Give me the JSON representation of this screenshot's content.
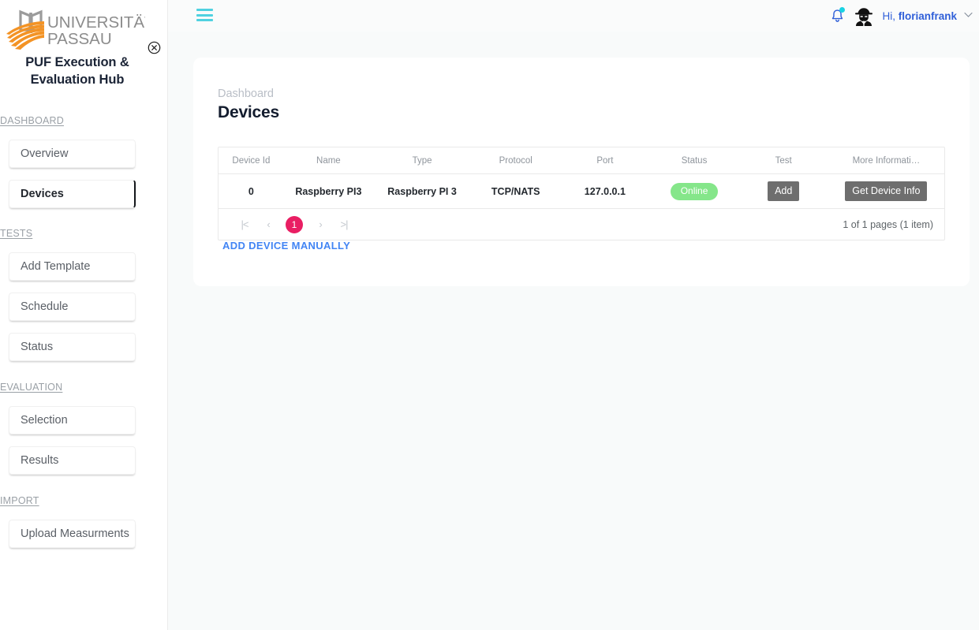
{
  "sidebar": {
    "logo": {
      "icon": "university-passau-logo",
      "line1": "UNIVERSITÄT",
      "line2": "PASSAU",
      "book_color": "#9b9b9b",
      "field_color": "#f39325"
    },
    "collapse_icon": "close-circle-icon",
    "app_title": "PUF Execution & Evaluation Hub",
    "sections": [
      {
        "heading": "DASHBOARD",
        "items": [
          {
            "label": "Overview",
            "active": false
          },
          {
            "label": "Devices",
            "active": true
          }
        ]
      },
      {
        "heading": "TESTS",
        "items": [
          {
            "label": "Add Template",
            "active": false
          },
          {
            "label": "Schedule",
            "active": false
          },
          {
            "label": "Status",
            "active": false
          }
        ]
      },
      {
        "heading": "EVALUATION",
        "items": [
          {
            "label": "Selection",
            "active": false
          },
          {
            "label": "Results",
            "active": false
          }
        ]
      },
      {
        "heading": "IMPORT",
        "items": [
          {
            "label": "Upload Measurments",
            "active": false
          }
        ]
      }
    ]
  },
  "header": {
    "menu_icon": "hamburger-menu-icon",
    "menu_color": "#4fd1e0",
    "bell_icon": "notification-bell-icon",
    "has_notification": true,
    "notification_dot_color": "#19d3e3",
    "avatar_icon": "spy-avatar-icon",
    "greeting_prefix": "Hi,",
    "username": "florianfrank",
    "username_color": "#2f5fd8",
    "chevron_icon": "chevron-down-icon"
  },
  "main": {
    "breadcrumb": "Dashboard",
    "page_title": "Devices",
    "table": {
      "columns": [
        "Device Id",
        "Name",
        "Type",
        "Protocol",
        "Port",
        "Status",
        "Test",
        "More Informati…"
      ],
      "rows": [
        {
          "device_id": "0",
          "name": "Raspberry PI3",
          "type": "Raspberry PI 3",
          "protocol": "TCP/NATS",
          "port": "127.0.0.1",
          "status": "Online",
          "status_color": "#85e68a",
          "test_button": "Add",
          "more_button": "Get Device Info"
        }
      ]
    },
    "pagination": {
      "first": "|<",
      "prev": "‹",
      "current": "1",
      "next": "›",
      "last": ">|",
      "current_color": "#e91e63",
      "info": "1 of 1 pages (1 item)"
    },
    "add_device_link": "ADD DEVICE MANUALLY",
    "add_device_link_color": "#4285f4"
  }
}
